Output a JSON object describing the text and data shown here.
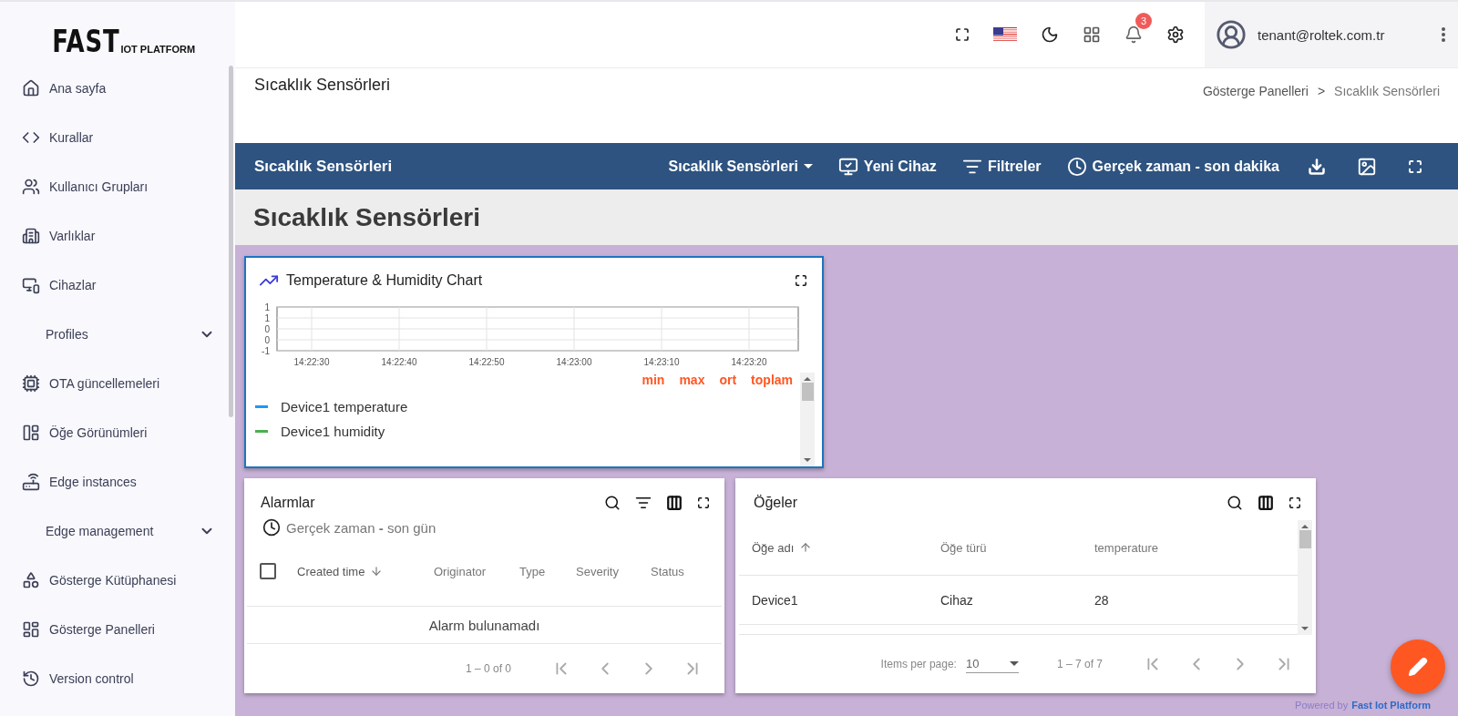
{
  "logo": {
    "main": "FAST",
    "sub": "IOT PLATFORM"
  },
  "sidebar": {
    "items": [
      {
        "kind": "link",
        "label": "Ana sayfa"
      },
      {
        "kind": "link",
        "label": "Kurallar"
      },
      {
        "kind": "link",
        "label": "Kullanıcı Grupları"
      },
      {
        "kind": "link",
        "label": "Varlıklar"
      },
      {
        "kind": "link",
        "label": "Cihazlar"
      },
      {
        "kind": "group",
        "label": "Profiles",
        "expanded": false
      },
      {
        "kind": "link",
        "label": "OTA güncellemeleri"
      },
      {
        "kind": "link",
        "label": "Öğe Görünümleri"
      },
      {
        "kind": "link",
        "label": "Edge instances"
      },
      {
        "kind": "group",
        "label": "Edge management",
        "expanded": false
      },
      {
        "kind": "link",
        "label": "Gösterge Kütüphanesi"
      },
      {
        "kind": "link",
        "label": "Gösterge Panelleri"
      },
      {
        "kind": "link",
        "label": "Version control"
      }
    ]
  },
  "header": {
    "notification_count": "3",
    "user": "tenant@roltek.com.tr"
  },
  "page": {
    "title": "Sıcaklık Sensörleri",
    "breadcrumb": [
      "Gösterge Panelleri",
      "Sıcaklık Sensörleri"
    ],
    "breadcrumb_separator": ">"
  },
  "toolbar": {
    "title": "Sıcaklık Sensörleri",
    "state_select": "Sıcaklık Sensörleri",
    "new_device": "Yeni Cihaz",
    "filters": "Filtreler",
    "timewindow": "Gerçek zaman - son dakika"
  },
  "dashboard": {
    "title": "Sıcaklık Sensörleri"
  },
  "chart_widget": {
    "title": "Temperature & Humidity Chart",
    "chart_data": {
      "type": "line",
      "grid": true,
      "categories": [
        "14:22:30",
        "14:22:40",
        "14:22:50",
        "14:23:00",
        "14:23:10",
        "14:23:20"
      ],
      "ylim": [
        -1,
        1
      ],
      "yticks": [
        {
          "value": 1,
          "label": "1"
        },
        {
          "value": 0.5,
          "label": "1"
        },
        {
          "value": 0,
          "label": "0"
        },
        {
          "value": -0.5,
          "label": "0"
        },
        {
          "value": -1,
          "label": "-1"
        }
      ]
    },
    "legend_headers": [
      "min",
      "max",
      "ort",
      "toplam"
    ],
    "legend": [
      {
        "name": "Device1 temperature",
        "color": "#2196f3"
      },
      {
        "name": "Device1 humidity",
        "color": "#4caf50"
      }
    ]
  },
  "alarms_widget": {
    "title": "Alarmlar",
    "timewindow": "Gerçek zaman **-** son gün",
    "select_all_checked": false,
    "columns": [
      {
        "label": "Created time",
        "sorted": true,
        "descending": true
      },
      {
        "label": "Originator",
        "sorted": false
      },
      {
        "label": "Type",
        "sorted": false
      },
      {
        "label": "Severity",
        "sorted": false
      },
      {
        "label": "Status",
        "sorted": false
      }
    ],
    "empty_message": "Alarm bulunamadı",
    "range": "1 – 0 of 0"
  },
  "entities_widget": {
    "title": "Öğeler",
    "columns": [
      {
        "label": "Öğe adı",
        "sorted": true
      },
      {
        "label": "Öğe türü",
        "sorted": false
      },
      {
        "label": "temperature",
        "sorted": false
      }
    ],
    "rows": [
      [
        "Device1",
        "Cihaz",
        "28"
      ]
    ],
    "items_per_page_label": "Items per page:",
    "items_per_page": "10",
    "range": "1 – 7 of 7"
  },
  "footer": {
    "powered_by": "Powered by",
    "brand": "Fast Iot Platform"
  }
}
